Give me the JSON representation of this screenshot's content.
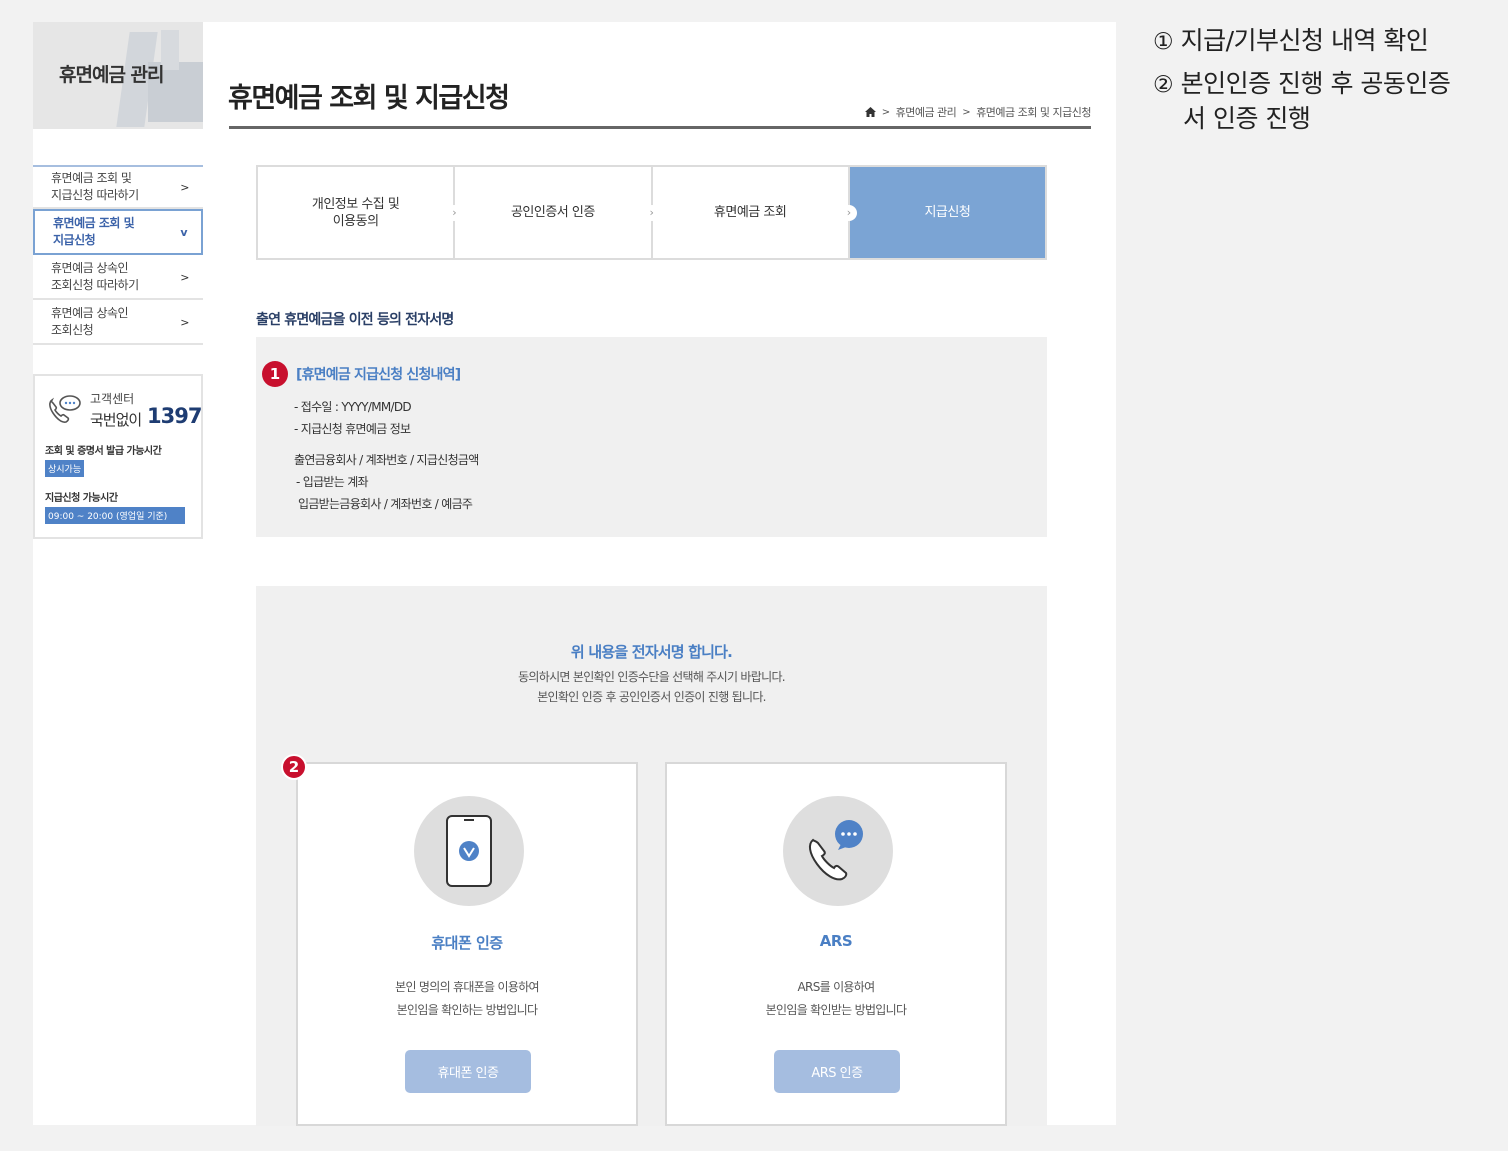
{
  "sidebar": {
    "title": "휴면예금 관리",
    "items": [
      {
        "label": "휴면예금 조회 및 지급신청 따라하기",
        "line1": "휴면예금 조회 및",
        "line2": "지급신청 따라하기",
        "chevron": ">"
      },
      {
        "label": "휴면예금 조회 및 지급신청",
        "line1": "휴면예금 조회 및",
        "line2": "지급신청",
        "chevron": "v"
      },
      {
        "label": "휴면예금 상속인 조회신청 따라하기",
        "line1": "휴면예금 상속인",
        "line2": "조회신청 따라하기",
        "chevron": ">"
      },
      {
        "label": "휴면예금 상속인 조회신청",
        "line1": "휴면예금 상속인",
        "line2": "조회신청",
        "chevron": ">"
      }
    ],
    "customer_center": {
      "label": "고객센터",
      "number_label": "국번없이",
      "number": "1397",
      "hours1_title": "조회 및 증명서 발급 가능시간",
      "hours1_badge": "상시가능",
      "hours2_title": "지급신청 가능시간",
      "hours2_badge": "09:00 ~ 20:00 (영업일 기준)"
    }
  },
  "header": {
    "title": "휴면예금 조회 및 지급신청",
    "breadcrumb": [
      "휴면예금 관리",
      "휴면예금 조회 및 지급신청"
    ],
    "breadcrumb_sep": ">"
  },
  "steps": [
    {
      "line1": "개인정보 수집 및",
      "line2": "이용동의",
      "active": false
    },
    {
      "line1": "공인인증서 인증",
      "line2": "",
      "active": false
    },
    {
      "line1": "휴면예금 조회",
      "line2": "",
      "active": false
    },
    {
      "line1": "지급신청",
      "line2": "",
      "active": true
    }
  ],
  "section": {
    "title": "출연 휴면예금을 이전 등의 전자서명",
    "badge": "1",
    "heading": "[휴면예금 지급신청 신청내역]",
    "lines": [
      "- 접수일 : YYYY/MM/DD",
      "- 지급신청 휴면예금 정보",
      "출연금융회사 / 계좌번호 / 지급신청금액",
      " - 입급받는 계좌",
      " 입금받는금융회사 / 계좌번호 / 예금주"
    ]
  },
  "signature": {
    "title": "위 내용을 전자서명 합니다.",
    "desc1": "동의하시면 본인확인 인증수단을 선택해 주시기 바랍니다.",
    "desc2": "본인확인 인증 후 공인인증서 인증이 진행 됩니다.",
    "badge": "2",
    "cards": [
      {
        "title": "휴대폰 인증",
        "desc1": "본인 명의의 휴대폰을 이용하여",
        "desc2": "본인임을 확인하는 방법입니다",
        "button": "휴대폰 인증"
      },
      {
        "title": "ARS",
        "desc1": "ARS를 이용하여",
        "desc2": "본인임을 확인받는 방법입니다",
        "button": "ARS 인증"
      }
    ]
  },
  "notes": [
    {
      "num": "①",
      "text": "지급/기부신청 내역 확인"
    },
    {
      "num": "②",
      "text": "본인인증 진행 후 공동인증",
      "text2": "서 인증 진행"
    }
  ],
  "colors": {
    "accent": "#7ba4d4",
    "heading_blue": "#4a7fc4",
    "badge_red": "#c8102e",
    "button_blue": "#a5bde0"
  }
}
